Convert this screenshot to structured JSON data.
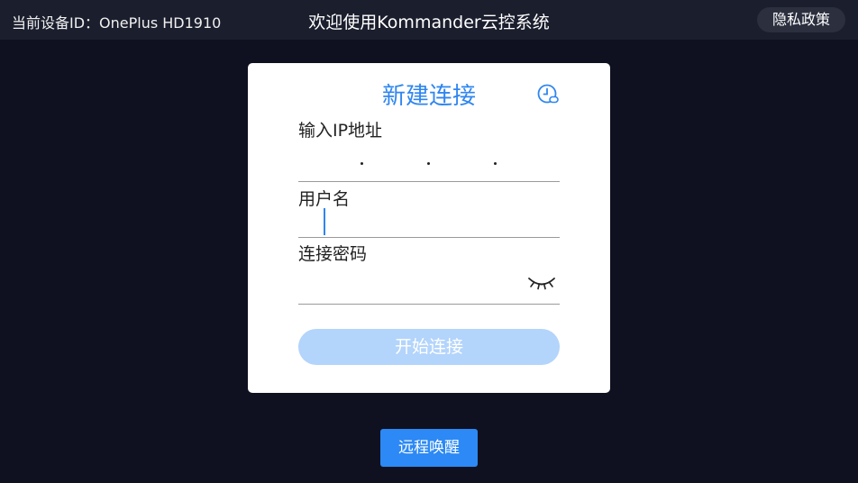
{
  "header": {
    "device_id": "当前设备ID：OnePlus HD1910",
    "welcome": "欢迎使用Kommander云控系统",
    "privacy_label": "隐私政策"
  },
  "card": {
    "title": "新建连接",
    "history_icon": "history-clock-icon",
    "ip_label": "输入IP地址",
    "username_label": "用户名",
    "password_label": "连接密码",
    "password_toggle_icon": "eye-closed-icon",
    "connect_label": "开始连接"
  },
  "footer": {
    "wake_label": "远程唤醒"
  },
  "colors": {
    "accent": "#2f86f0",
    "button_disabled": "#b3d4fb",
    "background": "#0f1120",
    "topbar": "#1b1e2d"
  }
}
